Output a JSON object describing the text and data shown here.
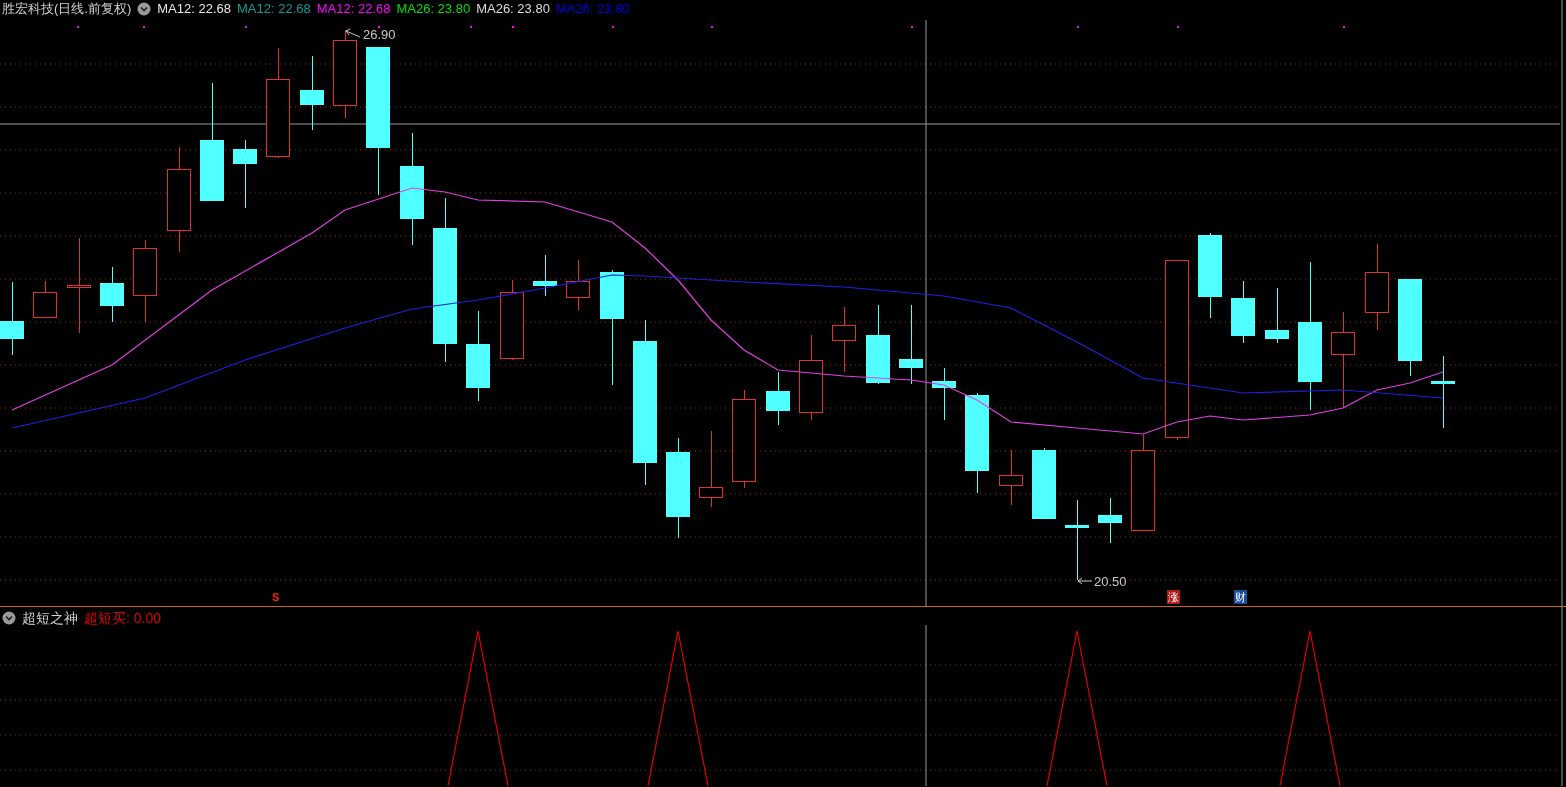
{
  "main_panel": {
    "title": "胜宏科技(日线.前复权)",
    "indicators": [
      {
        "text": "MA12: 22.68",
        "color": "#e8e8e8"
      },
      {
        "text": "MA12: 22.68",
        "color": "#0e9a9a"
      },
      {
        "text": "MA12: 22.68",
        "color": "#ff00ff"
      },
      {
        "text": "MA26: 23.80",
        "color": "#00e000"
      },
      {
        "text": "MA26: 23.80",
        "color": "#dcdcdc"
      },
      {
        "text": "MA26: 23.80",
        "color": "#0000e0"
      }
    ],
    "high_label": "26.90",
    "low_label": "20.50",
    "signal_mark": "S",
    "event_badges": [
      {
        "text": "涨",
        "kind": "rise"
      },
      {
        "text": "财",
        "kind": "finance"
      }
    ]
  },
  "sub_panel": {
    "title": "超短之神",
    "indicator": {
      "text": "超短买: 0.00",
      "color": "#e00000"
    }
  }
}
